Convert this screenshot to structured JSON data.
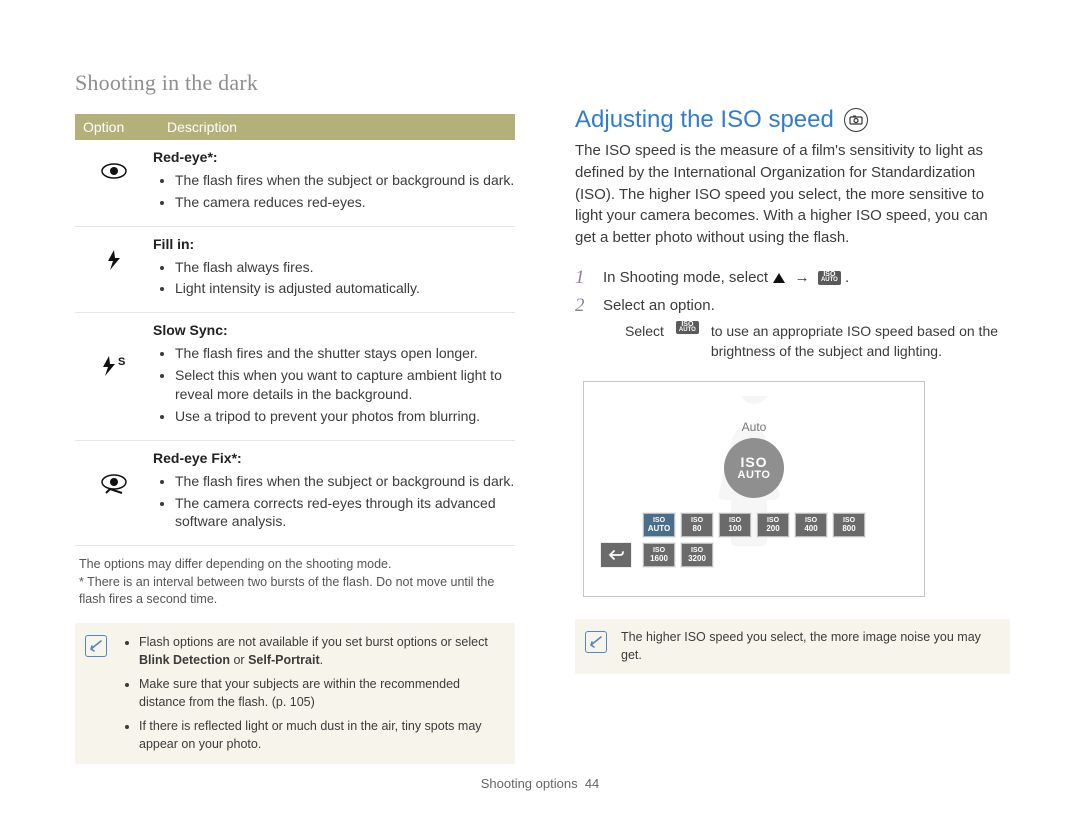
{
  "section_title": "Shooting in the dark",
  "table": {
    "headers": {
      "option": "Option",
      "description": "Description"
    },
    "rows": [
      {
        "icon": "eye-icon",
        "name": "Red-eye*:",
        "bullets": [
          "The flash fires when the subject or background is dark.",
          "The camera reduces red-eyes."
        ]
      },
      {
        "icon": "flash-fill-icon",
        "name": "Fill in:",
        "bullets": [
          "The flash always fires.",
          "Light intensity is adjusted automatically."
        ]
      },
      {
        "icon": "slow-sync-icon",
        "name": "Slow Sync:",
        "bullets": [
          "The flash fires and the shutter stays open longer.",
          "Select this when you want to capture ambient light to reveal more details in the background.",
          "Use a tripod to prevent your photos from blurring."
        ]
      },
      {
        "icon": "redeye-fix-icon",
        "name": "Red-eye Fix*:",
        "bullets": [
          "The flash fires when the subject or background is dark.",
          "The camera corrects red-eyes through its advanced software analysis."
        ]
      }
    ]
  },
  "footnotes": {
    "line1": "The options may differ depending on the shooting mode.",
    "line2": "* There is an interval between two bursts of the flash. Do not move until the flash fires a second time."
  },
  "note_left": {
    "items": [
      {
        "pre": "Flash options are not available if you set burst options or select ",
        "bold1": "Blink Detection",
        "mid": " or ",
        "bold2": "Self-Portrait",
        "post": "."
      },
      {
        "text": "Make sure that your subjects are within the recommended distance from the flash. (p. 105)"
      },
      {
        "text": "If there is reflected light or much dust in the air, tiny spots may appear on your photo."
      }
    ]
  },
  "right": {
    "heading": "Adjusting the ISO speed",
    "body": "The ISO speed is the measure of a film's sensitivity to light as defined by the International Organization for Standardization (ISO). The higher ISO speed you select, the more sensitive to light your camera becomes. With a higher ISO speed, you can get a better photo without using the flash.",
    "steps": [
      {
        "num": "1",
        "text_pre": "In Shooting mode, select ",
        "text_post": "."
      },
      {
        "num": "2",
        "text": "Select an option.",
        "sub_pre": "Select ",
        "sub_post": " to use an appropriate ISO speed based on the brightness of the subject and lighting."
      }
    ],
    "screen": {
      "label": "Auto",
      "iso_top": "ISO",
      "iso_bot": "AUTO",
      "chips": [
        "AUTO",
        "80",
        "100",
        "200",
        "400",
        "800",
        "1600",
        "3200"
      ],
      "chip_prefix": "ISO"
    },
    "note": "The higher ISO speed you select, the more image noise you may get."
  },
  "footer": {
    "section": "Shooting options",
    "page": "44"
  }
}
